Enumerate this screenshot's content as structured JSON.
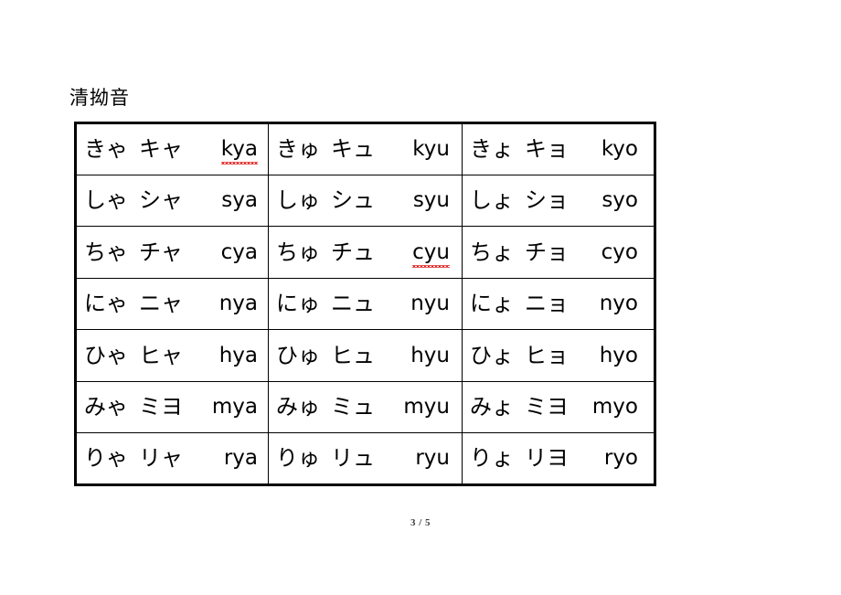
{
  "document": {
    "heading": "清拗音",
    "page_number": "3 / 5"
  },
  "table": {
    "rows": [
      {
        "cells": [
          {
            "hiragana": "きゃ",
            "katakana": "キャ",
            "romaji": "kya",
            "misspelled": true
          },
          {
            "hiragana": "きゅ",
            "katakana": "キュ",
            "romaji": "kyu",
            "misspelled": false
          },
          {
            "hiragana": "きょ",
            "katakana": "キョ",
            "romaji": "kyo",
            "misspelled": false
          }
        ]
      },
      {
        "cells": [
          {
            "hiragana": "しゃ",
            "katakana": "シャ",
            "romaji": "sya",
            "misspelled": false
          },
          {
            "hiragana": "しゅ",
            "katakana": "シュ",
            "romaji": "syu",
            "misspelled": false
          },
          {
            "hiragana": "しょ",
            "katakana": "ショ",
            "romaji": "syo",
            "misspelled": false
          }
        ]
      },
      {
        "cells": [
          {
            "hiragana": "ちゃ",
            "katakana": "チャ",
            "romaji": "cya",
            "misspelled": false
          },
          {
            "hiragana": "ちゅ",
            "katakana": "チュ",
            "romaji": "cyu",
            "misspelled": true
          },
          {
            "hiragana": "ちょ",
            "katakana": "チョ",
            "romaji": "cyo",
            "misspelled": false
          }
        ]
      },
      {
        "cells": [
          {
            "hiragana": "にゃ",
            "katakana": "ニャ",
            "romaji": "nya",
            "misspelled": false
          },
          {
            "hiragana": "にゅ",
            "katakana": "ニュ",
            "romaji": "nyu",
            "misspelled": false
          },
          {
            "hiragana": "にょ",
            "katakana": "ニョ",
            "romaji": "nyo",
            "misspelled": false
          }
        ]
      },
      {
        "cells": [
          {
            "hiragana": "ひゃ",
            "katakana": "ヒャ",
            "romaji": "hya",
            "misspelled": false
          },
          {
            "hiragana": "ひゅ",
            "katakana": "ヒュ",
            "romaji": "hyu",
            "misspelled": false
          },
          {
            "hiragana": "ひょ",
            "katakana": "ヒョ",
            "romaji": "hyo",
            "misspelled": false
          }
        ]
      },
      {
        "cells": [
          {
            "hiragana": "みゃ",
            "katakana": "ミヨ",
            "romaji": "mya",
            "misspelled": false
          },
          {
            "hiragana": "みゅ",
            "katakana": "ミュ",
            "romaji": "myu",
            "misspelled": false
          },
          {
            "hiragana": "みょ",
            "katakana": "ミヨ",
            "romaji": "myo",
            "misspelled": false
          }
        ]
      },
      {
        "cells": [
          {
            "hiragana": "りゃ",
            "katakana": "リャ",
            "romaji": "rya",
            "misspelled": false
          },
          {
            "hiragana": "りゅ",
            "katakana": "リュ",
            "romaji": "ryu",
            "misspelled": false
          },
          {
            "hiragana": "りょ",
            "katakana": "リヨ",
            "romaji": "ryo",
            "misspelled": false
          }
        ]
      }
    ]
  },
  "colors": {
    "text": "#000000",
    "border": "#000000",
    "spellcheck_underline": "#e01b1b",
    "page_background": "#ffffff"
  }
}
